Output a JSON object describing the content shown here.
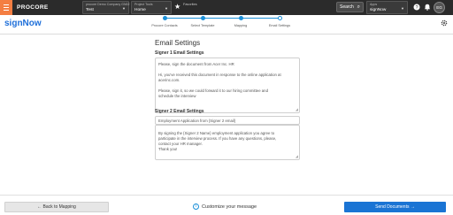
{
  "topbar": {
    "logo": "PROCORE",
    "company": {
      "label": "procore Demo Company GN02",
      "value": "Test"
    },
    "project": {
      "label": "Project Tools",
      "value": "Home"
    },
    "favorites_label": "Favorites",
    "search_label": "Search",
    "apps": {
      "label": "Apps",
      "value": "signNow"
    },
    "avatar_initials": "EG"
  },
  "app": {
    "brand": "signNow"
  },
  "stepper": {
    "steps": [
      "Procore Contacts",
      "Select Template",
      "Mapping",
      "Email Settings"
    ],
    "active_index": 3
  },
  "main": {
    "title": "Email Settings",
    "signer1": {
      "heading": "Signer 1 Email Settings",
      "lines": [
        "Please, sign the document from Acer Inc. HR",
        "",
        "Hi, you've received this document in response to the online application at",
        "acerinc.com.",
        "",
        "Please, sign it, so we could forward it to our hiring committee and",
        "schedule the interview"
      ]
    },
    "signer2": {
      "heading": "Signer 2 Email Settings",
      "subject": "Employment Application from {Signer 2 email}",
      "lines": [
        "By signing the {Signer 2 Name} employment application you agree to",
        "participate in the interview process. If you have any questions, please,",
        "contact your HR manager.",
        "Thank you!"
      ]
    }
  },
  "footer": {
    "back_label": "←  Back to Mapping",
    "customize_label": "Customize your message",
    "send_label": "Send Documents  →"
  },
  "colors": {
    "accent": "#1a8fd8",
    "primary_button": "#1a74d4",
    "procore_orange": "#f47e42",
    "topbar": "#2b2b2b"
  }
}
